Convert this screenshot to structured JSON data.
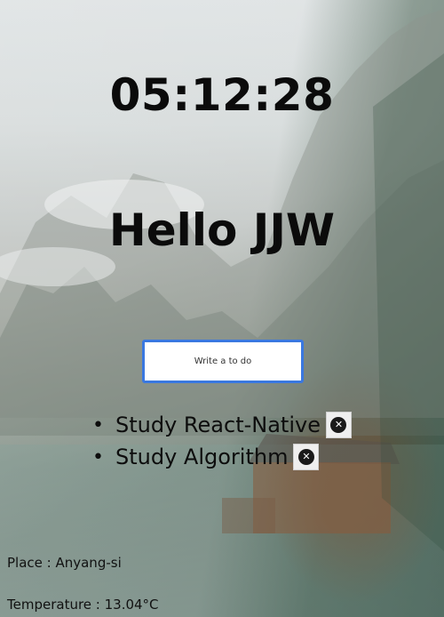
{
  "clock": {
    "time": "05:12:28"
  },
  "greeting": {
    "text": "Hello JJW"
  },
  "todo": {
    "placeholder": "Write a to do",
    "items": [
      {
        "text": "Study React-Native",
        "delete_icon": "close-icon"
      },
      {
        "text": "Study Algorithm",
        "delete_icon": "close-icon"
      }
    ]
  },
  "weather": {
    "place_label": "Place : Anyang-si",
    "temperature_label": "Temperature : 13.04°C"
  },
  "colors": {
    "input_border": "#3a78e0",
    "text": "#0b0b0b"
  }
}
